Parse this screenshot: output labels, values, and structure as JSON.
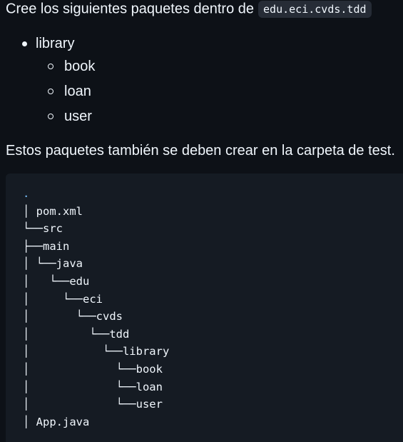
{
  "intro": {
    "text": "Cree los siguientes paquetes dentro de",
    "code": "edu.eci.cvds.tdd"
  },
  "list": {
    "item": "library",
    "subitems": [
      "book",
      "loan",
      "user"
    ]
  },
  "paragraph": "Estos paquetes también se deben crear en la carpeta de test.",
  "tree": {
    "root": ".",
    "lines": [
      "│ pom.xml",
      "└──src",
      "├──main",
      "│ └──java",
      "│   └──edu",
      "│     └──eci",
      "│       └──cvds",
      "│         └──tdd",
      "│           └──library",
      "│             └──book",
      "│             └──loan",
      "│             └──user",
      "│ App.java"
    ]
  },
  "colors": {
    "background": "#0d1117",
    "code_background": "#151b23",
    "inline_code_background": "#262c36",
    "text": "#f0f6fc",
    "accent": "#79c0ff"
  }
}
